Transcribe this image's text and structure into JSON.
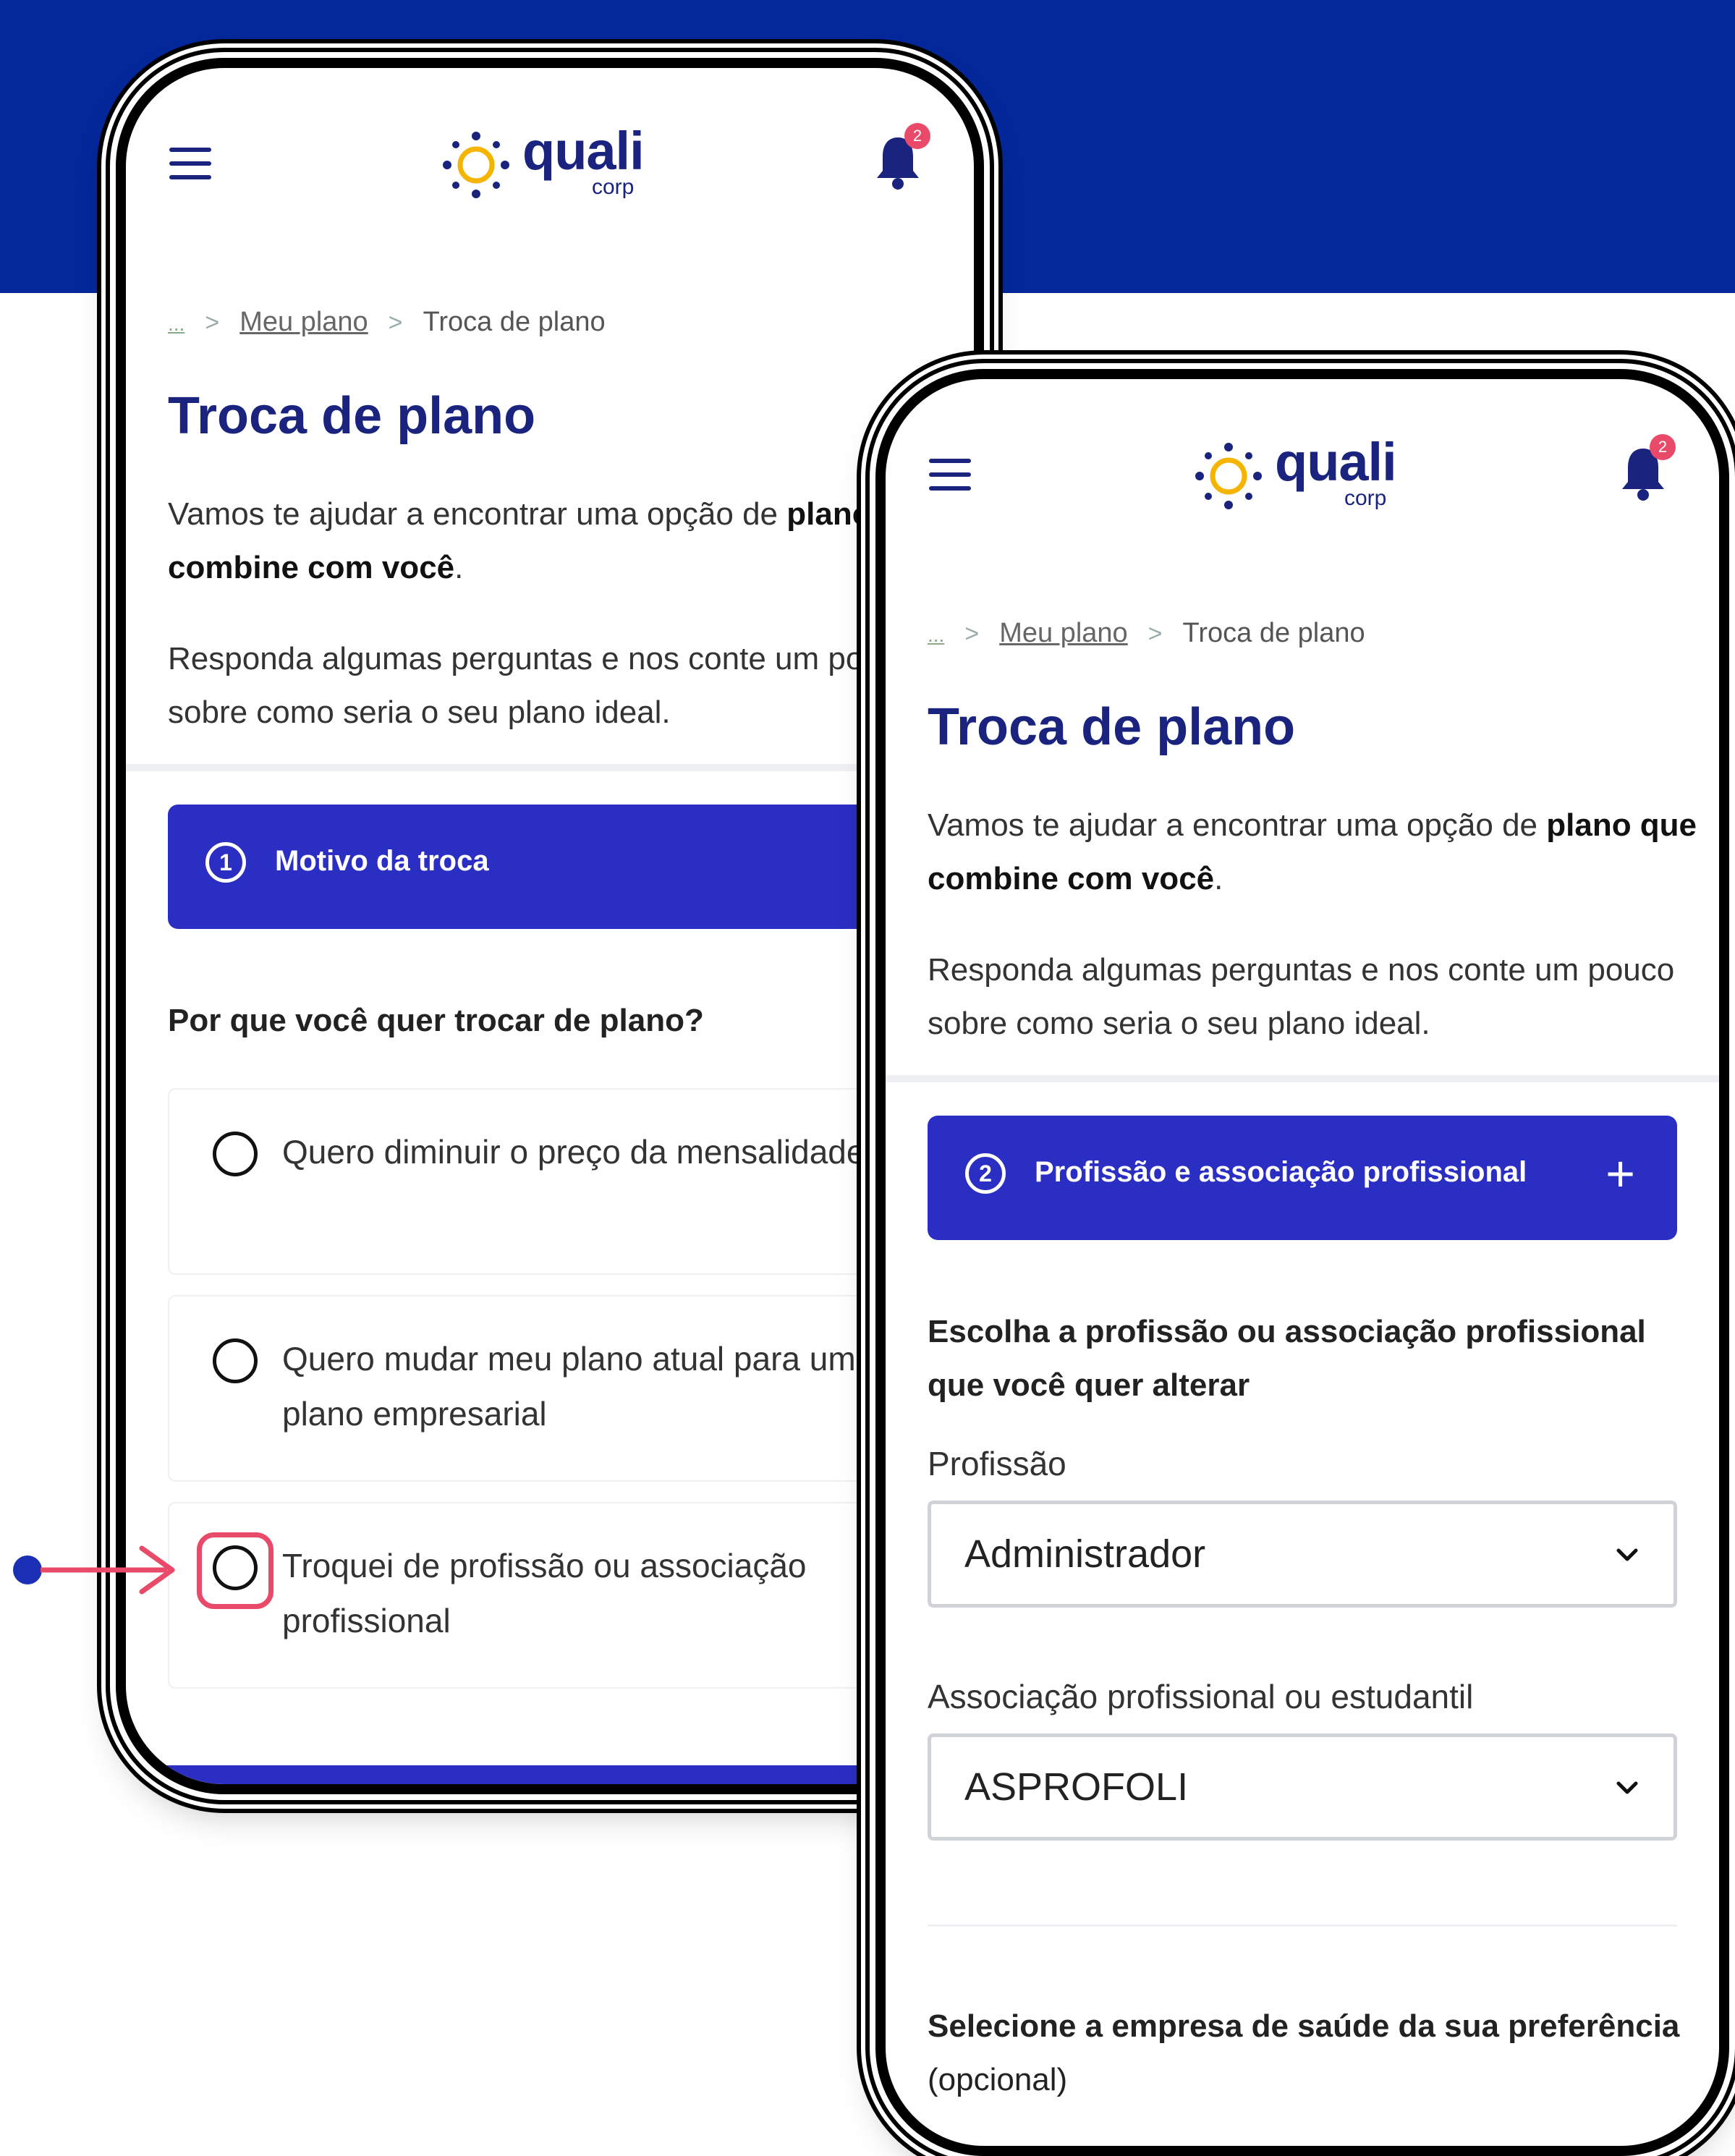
{
  "brand": {
    "logo_word": "quali",
    "logo_sub": "corp",
    "primary_color": "#04279a",
    "accent_color": "#2b2ec2",
    "highlight_color": "#e94a6a"
  },
  "header": {
    "notification_count": "2"
  },
  "breadcrumb": {
    "ellipsis": "...",
    "separator": ">",
    "parent": "Meu plano",
    "current": "Troca de plano"
  },
  "page": {
    "title": "Troca de plano",
    "intro_part1": "Vamos te ajudar a encontrar uma opção de ",
    "intro_bold": "plano que combine com você",
    "intro_end": ".",
    "intro_2": "Responda algumas perguntas e nos conte um pouco sobre como seria o seu plano ideal."
  },
  "step1": {
    "number": "1",
    "label": "Motivo da troca",
    "question": "Por que você quer trocar de plano?",
    "options": [
      "Quero diminuir o preço da mensalidade",
      "Quero mudar meu plano atual para um plano empresarial",
      "Troquei de profissão ou associação profissional"
    ]
  },
  "step2": {
    "number": "2",
    "label": "Profissão e associação profissional",
    "expand_icon": "+",
    "question": "Escolha a profissão ou associação profissional que você quer alterar",
    "profession_label": "Profissão",
    "profession_value": "Administrador",
    "association_label": "Associação profissional ou estudantil",
    "association_value": "ASPROFOLI",
    "company_question_bold": "Selecione a empresa de saúde da sua preferência",
    "company_question_optional": " (opcional)"
  }
}
